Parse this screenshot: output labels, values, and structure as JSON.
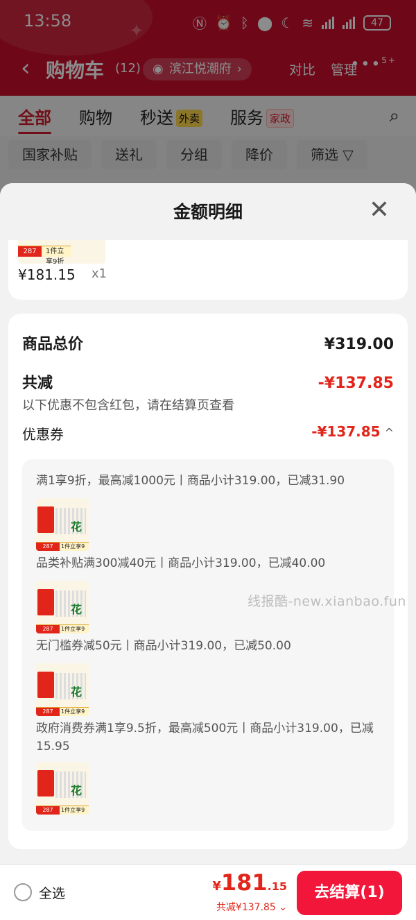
{
  "status_bar": {
    "time": "13:58",
    "battery": "47"
  },
  "header": {
    "title": "购物车",
    "count": "(12)",
    "location": "滨江悦潮府",
    "compare": "对比",
    "manage": "管理",
    "more_badge": "5+"
  },
  "tabs": [
    {
      "label": "全部",
      "badge": ""
    },
    {
      "label": "购物",
      "badge": ""
    },
    {
      "label": "秒送",
      "badge": "外卖"
    },
    {
      "label": "服务",
      "badge": "家政"
    }
  ],
  "filters": [
    "国家补贴",
    "送礼",
    "分组",
    "降价",
    "筛选"
  ],
  "sheet": {
    "title": "金额明细",
    "product": {
      "price": "¥181.15",
      "qty": "x1",
      "thumb_price": "287",
      "thumb_promo": "1件立享9折"
    },
    "summary": {
      "goods_total_label": "商品总价",
      "goods_total_value": "¥319.00",
      "discount_label": "共减",
      "discount_value": "-¥137.85",
      "note": "以下优惠不包含红包，请在结算页查看",
      "coupon_label": "优惠券",
      "coupon_value": "-¥137.85"
    },
    "coupons": [
      {
        "text": "满1享9折，最高减1000元丨商品小计319.00，已减31.90"
      },
      {
        "text": "品类补贴满300减40元丨商品小计319.00，已减40.00"
      },
      {
        "text": "无门槛券减50元丨商品小计319.00，已减50.00"
      },
      {
        "text": "政府消费券满1享9.5折，最高减500元丨商品小计319.00，已减15.95"
      }
    ],
    "thumb": {
      "price": "287",
      "promo": "1件立享9折",
      "flower": "花"
    }
  },
  "watermark": "线报酷-new.xianbao.fun",
  "bottom_bar": {
    "select_all": "全选",
    "currency": "¥",
    "total_int": "181",
    "total_dec": ".15",
    "saved": "共减¥137.85",
    "checkout": "去结算(1)"
  },
  "colors": {
    "brand_red": "#c8102e",
    "price_red": "#e1251b",
    "checkout": "#f2173a"
  },
  "icons": [
    "back-icon",
    "eye-icon",
    "chevron-right-icon",
    "more-icon",
    "search-icon",
    "filter-icon",
    "close-icon",
    "chevron-up-icon",
    "chevron-down-icon"
  ]
}
